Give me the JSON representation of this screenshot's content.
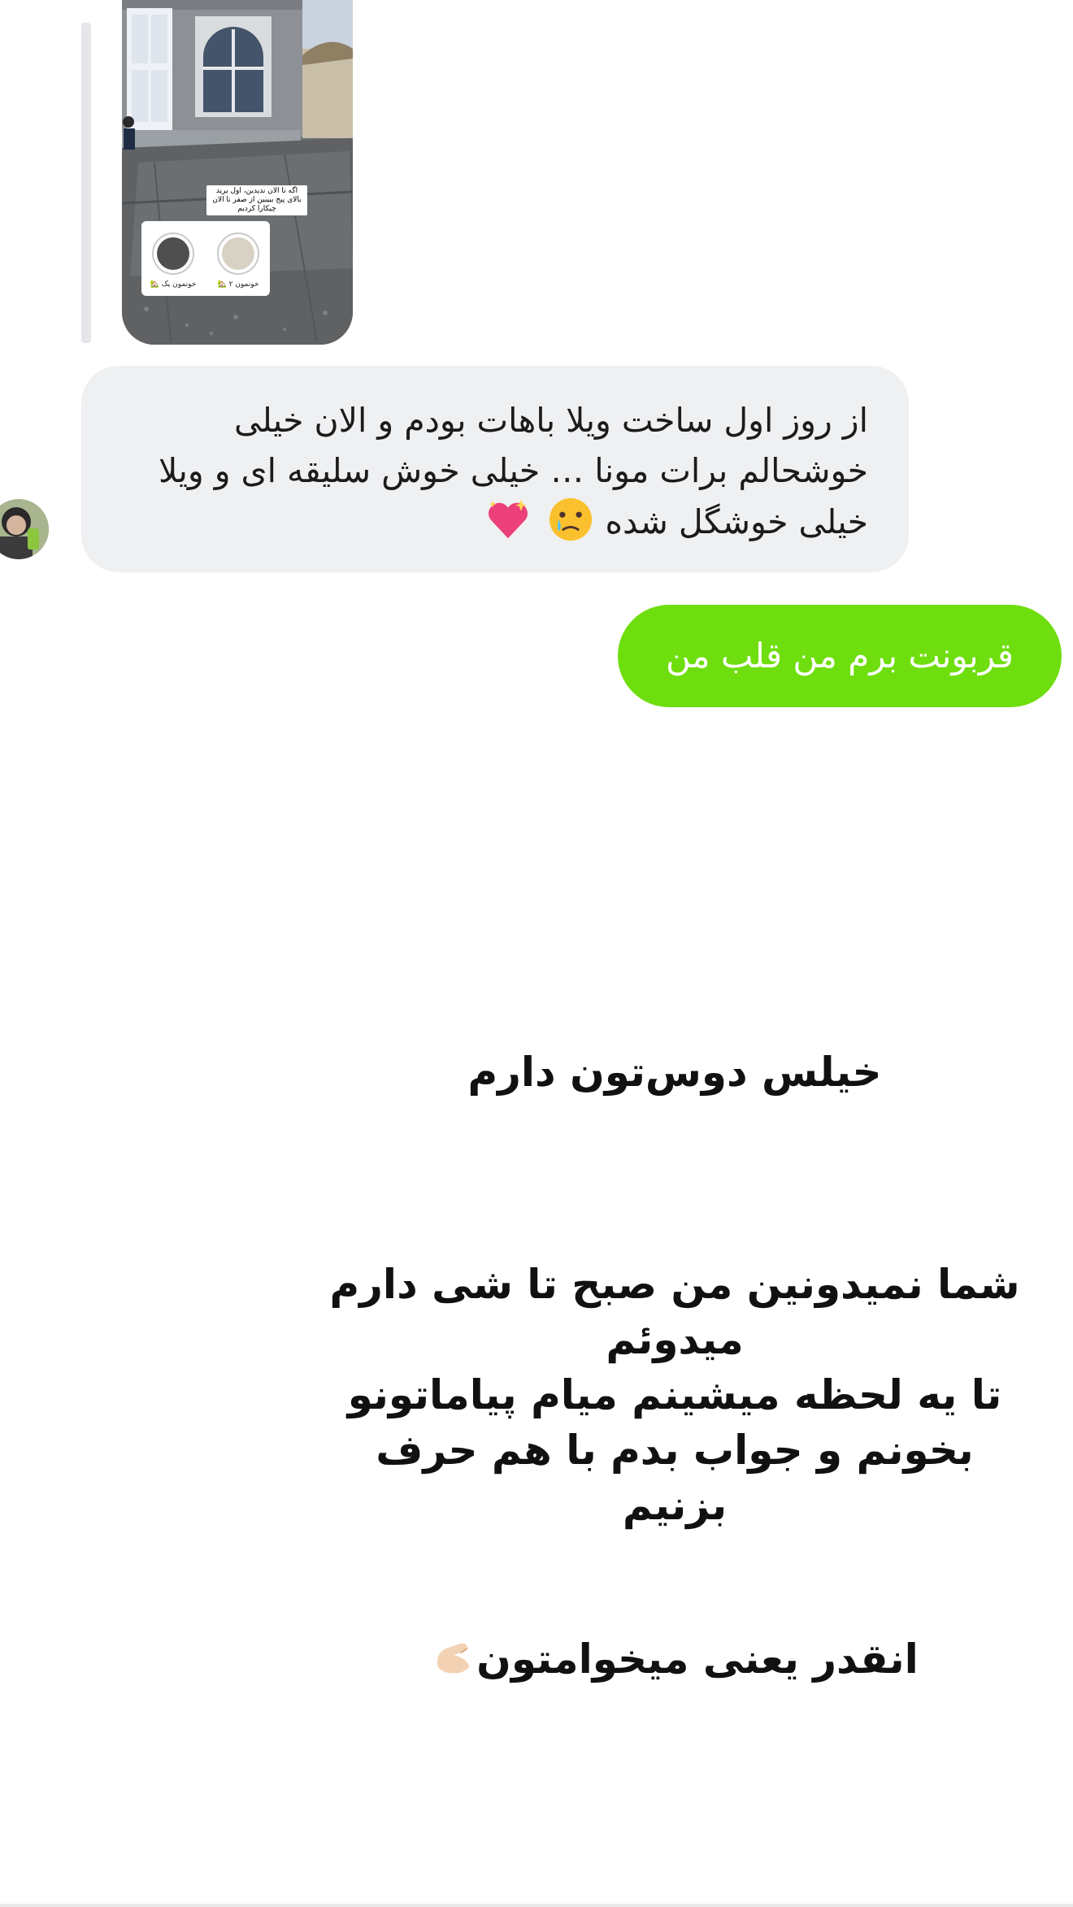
{
  "shared_post": {
    "caption": "اگه تا الان ندیدین، اول برید بالای پیج ببینین از صفر تا الان چیکارا کردیم",
    "highlights": [
      {
        "label": "خونمون ۲ 🏡"
      },
      {
        "label": "خونمون یک 🏡"
      }
    ]
  },
  "messages": [
    {
      "direction": "incoming",
      "text": "از روز اول ساخت ویلا باهات بودم و الان خیلی خوشحالم برات مونا … خیلی خوش سلیقه ای و ویلا خیلی خوشگل شده",
      "emojis": [
        "crying-face-emoji",
        "sparkling-heart-emoji"
      ]
    },
    {
      "direction": "outgoing",
      "text": "قربونت برم من قلب من",
      "color": "#6ede0e"
    }
  ],
  "story_text": {
    "line1": "خیلس دوس‌تون دارم",
    "para2_a": "شما نمیدونین من صبح تا شی دارم میدوئم",
    "para2_b": "تا یه لحظه میشینم میام پیاماتونو بخونم و جواب بدم با هم حرف بزنیم",
    "line3": "انقدر یعنی میخوامتون",
    "line3_emoji": "pinching-hand-emoji"
  }
}
